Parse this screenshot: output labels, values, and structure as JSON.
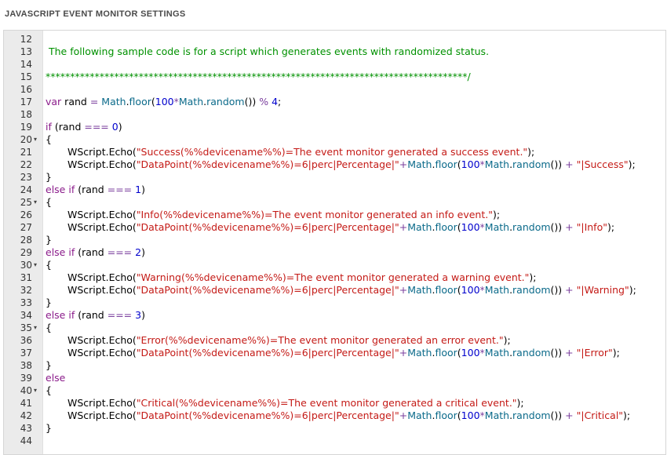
{
  "section": {
    "title": "JAVASCRIPT EVENT MONITOR SETTINGS"
  },
  "colors": {
    "gutter": "#ebebeb",
    "keyword": "#8b1c8b",
    "number": "#0000cd",
    "string": "#c41a16",
    "property": "#0b6a8a",
    "operator": "#7a3e9d",
    "comment": "#009100"
  },
  "editor": {
    "lines": [
      {
        "number": "12",
        "fold": false,
        "indent": false,
        "tokens": []
      },
      {
        "number": "13",
        "fold": false,
        "indent": false,
        "tokens": [
          {
            "t": "cm",
            "v": " The following sample code is for a script which generates events with randomized status."
          }
        ]
      },
      {
        "number": "14",
        "fold": false,
        "indent": false,
        "tokens": []
      },
      {
        "number": "15",
        "fold": false,
        "indent": false,
        "tokens": [
          {
            "t": "cm",
            "v": "**************************************************************************************/"
          }
        ]
      },
      {
        "number": "16",
        "fold": false,
        "indent": false,
        "tokens": []
      },
      {
        "number": "17",
        "fold": false,
        "indent": false,
        "tokens": [
          {
            "t": "kw",
            "v": "var"
          },
          {
            "t": "pl",
            "v": " rand "
          },
          {
            "t": "op",
            "v": "="
          },
          {
            "t": "pl",
            "v": " "
          },
          {
            "t": "prop",
            "v": "Math"
          },
          {
            "t": "pl",
            "v": "."
          },
          {
            "t": "prop",
            "v": "floor"
          },
          {
            "t": "pl",
            "v": "("
          },
          {
            "t": "num",
            "v": "100"
          },
          {
            "t": "op",
            "v": "*"
          },
          {
            "t": "prop",
            "v": "Math"
          },
          {
            "t": "pl",
            "v": "."
          },
          {
            "t": "prop",
            "v": "random"
          },
          {
            "t": "pl",
            "v": "()) "
          },
          {
            "t": "op",
            "v": "%"
          },
          {
            "t": "pl",
            "v": " "
          },
          {
            "t": "num",
            "v": "4"
          },
          {
            "t": "pl",
            "v": ";"
          }
        ]
      },
      {
        "number": "18",
        "fold": false,
        "indent": false,
        "tokens": []
      },
      {
        "number": "19",
        "fold": false,
        "indent": false,
        "tokens": [
          {
            "t": "kw",
            "v": "if"
          },
          {
            "t": "pl",
            "v": " (rand "
          },
          {
            "t": "op",
            "v": "==="
          },
          {
            "t": "pl",
            "v": " "
          },
          {
            "t": "num",
            "v": "0"
          },
          {
            "t": "pl",
            "v": ")"
          }
        ]
      },
      {
        "number": "20",
        "fold": true,
        "indent": false,
        "tokens": [
          {
            "t": "pl",
            "v": "{"
          }
        ]
      },
      {
        "number": "21",
        "fold": false,
        "indent": true,
        "tokens": [
          {
            "t": "pl",
            "v": "WScript.Echo("
          },
          {
            "t": "str",
            "v": "\"Success(%%devicename%%)=The event monitor generated a success event.\""
          },
          {
            "t": "pl",
            "v": ");"
          }
        ]
      },
      {
        "number": "22",
        "fold": false,
        "indent": true,
        "tokens": [
          {
            "t": "pl",
            "v": "WScript.Echo("
          },
          {
            "t": "str",
            "v": "\"DataPoint(%%devicename%%)=6|perc|Percentage|\""
          },
          {
            "t": "op",
            "v": "+"
          },
          {
            "t": "prop",
            "v": "Math"
          },
          {
            "t": "pl",
            "v": "."
          },
          {
            "t": "prop",
            "v": "floor"
          },
          {
            "t": "pl",
            "v": "("
          },
          {
            "t": "num",
            "v": "100"
          },
          {
            "t": "op",
            "v": "*"
          },
          {
            "t": "prop",
            "v": "Math"
          },
          {
            "t": "pl",
            "v": "."
          },
          {
            "t": "prop",
            "v": "random"
          },
          {
            "t": "pl",
            "v": "()) "
          },
          {
            "t": "op",
            "v": "+"
          },
          {
            "t": "pl",
            "v": " "
          },
          {
            "t": "str",
            "v": "\"|Success\""
          },
          {
            "t": "pl",
            "v": ");"
          }
        ]
      },
      {
        "number": "23",
        "fold": false,
        "indent": false,
        "tokens": [
          {
            "t": "pl",
            "v": "}"
          }
        ]
      },
      {
        "number": "24",
        "fold": false,
        "indent": false,
        "tokens": [
          {
            "t": "kw",
            "v": "else"
          },
          {
            "t": "pl",
            "v": " "
          },
          {
            "t": "kw",
            "v": "if"
          },
          {
            "t": "pl",
            "v": " (rand "
          },
          {
            "t": "op",
            "v": "==="
          },
          {
            "t": "pl",
            "v": " "
          },
          {
            "t": "num",
            "v": "1"
          },
          {
            "t": "pl",
            "v": ")"
          }
        ]
      },
      {
        "number": "25",
        "fold": true,
        "indent": false,
        "tokens": [
          {
            "t": "pl",
            "v": "{"
          }
        ]
      },
      {
        "number": "26",
        "fold": false,
        "indent": true,
        "tokens": [
          {
            "t": "pl",
            "v": "WScript.Echo("
          },
          {
            "t": "str",
            "v": "\"Info(%%devicename%%)=The event monitor generated an info event.\""
          },
          {
            "t": "pl",
            "v": ");"
          }
        ]
      },
      {
        "number": "27",
        "fold": false,
        "indent": true,
        "tokens": [
          {
            "t": "pl",
            "v": "WScript.Echo("
          },
          {
            "t": "str",
            "v": "\"DataPoint(%%devicename%%)=6|perc|Percentage|\""
          },
          {
            "t": "op",
            "v": "+"
          },
          {
            "t": "prop",
            "v": "Math"
          },
          {
            "t": "pl",
            "v": "."
          },
          {
            "t": "prop",
            "v": "floor"
          },
          {
            "t": "pl",
            "v": "("
          },
          {
            "t": "num",
            "v": "100"
          },
          {
            "t": "op",
            "v": "*"
          },
          {
            "t": "prop",
            "v": "Math"
          },
          {
            "t": "pl",
            "v": "."
          },
          {
            "t": "prop",
            "v": "random"
          },
          {
            "t": "pl",
            "v": "()) "
          },
          {
            "t": "op",
            "v": "+"
          },
          {
            "t": "pl",
            "v": " "
          },
          {
            "t": "str",
            "v": "\"|Info\""
          },
          {
            "t": "pl",
            "v": ");"
          }
        ]
      },
      {
        "number": "28",
        "fold": false,
        "indent": false,
        "tokens": [
          {
            "t": "pl",
            "v": "}"
          }
        ]
      },
      {
        "number": "29",
        "fold": false,
        "indent": false,
        "tokens": [
          {
            "t": "kw",
            "v": "else"
          },
          {
            "t": "pl",
            "v": " "
          },
          {
            "t": "kw",
            "v": "if"
          },
          {
            "t": "pl",
            "v": " (rand "
          },
          {
            "t": "op",
            "v": "==="
          },
          {
            "t": "pl",
            "v": " "
          },
          {
            "t": "num",
            "v": "2"
          },
          {
            "t": "pl",
            "v": ")"
          }
        ]
      },
      {
        "number": "30",
        "fold": true,
        "indent": false,
        "tokens": [
          {
            "t": "pl",
            "v": "{"
          }
        ]
      },
      {
        "number": "31",
        "fold": false,
        "indent": true,
        "tokens": [
          {
            "t": "pl",
            "v": "WScript.Echo("
          },
          {
            "t": "str",
            "v": "\"Warning(%%devicename%%)=The event monitor generated a warning event.\""
          },
          {
            "t": "pl",
            "v": ");"
          }
        ]
      },
      {
        "number": "32",
        "fold": false,
        "indent": true,
        "tokens": [
          {
            "t": "pl",
            "v": "WScript.Echo("
          },
          {
            "t": "str",
            "v": "\"DataPoint(%%devicename%%)=6|perc|Percentage|\""
          },
          {
            "t": "op",
            "v": "+"
          },
          {
            "t": "prop",
            "v": "Math"
          },
          {
            "t": "pl",
            "v": "."
          },
          {
            "t": "prop",
            "v": "floor"
          },
          {
            "t": "pl",
            "v": "("
          },
          {
            "t": "num",
            "v": "100"
          },
          {
            "t": "op",
            "v": "*"
          },
          {
            "t": "prop",
            "v": "Math"
          },
          {
            "t": "pl",
            "v": "."
          },
          {
            "t": "prop",
            "v": "random"
          },
          {
            "t": "pl",
            "v": "()) "
          },
          {
            "t": "op",
            "v": "+"
          },
          {
            "t": "pl",
            "v": " "
          },
          {
            "t": "str",
            "v": "\"|Warning\""
          },
          {
            "t": "pl",
            "v": ");"
          }
        ]
      },
      {
        "number": "33",
        "fold": false,
        "indent": false,
        "tokens": [
          {
            "t": "pl",
            "v": "}"
          }
        ]
      },
      {
        "number": "34",
        "fold": false,
        "indent": false,
        "tokens": [
          {
            "t": "kw",
            "v": "else"
          },
          {
            "t": "pl",
            "v": " "
          },
          {
            "t": "kw",
            "v": "if"
          },
          {
            "t": "pl",
            "v": " (rand "
          },
          {
            "t": "op",
            "v": "==="
          },
          {
            "t": "pl",
            "v": " "
          },
          {
            "t": "num",
            "v": "3"
          },
          {
            "t": "pl",
            "v": ")"
          }
        ]
      },
      {
        "number": "35",
        "fold": true,
        "indent": false,
        "tokens": [
          {
            "t": "pl",
            "v": "{"
          }
        ]
      },
      {
        "number": "36",
        "fold": false,
        "indent": true,
        "tokens": [
          {
            "t": "pl",
            "v": "WScript.Echo("
          },
          {
            "t": "str",
            "v": "\"Error(%%devicename%%)=The event monitor generated an error event.\""
          },
          {
            "t": "pl",
            "v": ");"
          }
        ]
      },
      {
        "number": "37",
        "fold": false,
        "indent": true,
        "tokens": [
          {
            "t": "pl",
            "v": "WScript.Echo("
          },
          {
            "t": "str",
            "v": "\"DataPoint(%%devicename%%)=6|perc|Percentage|\""
          },
          {
            "t": "op",
            "v": "+"
          },
          {
            "t": "prop",
            "v": "Math"
          },
          {
            "t": "pl",
            "v": "."
          },
          {
            "t": "prop",
            "v": "floor"
          },
          {
            "t": "pl",
            "v": "("
          },
          {
            "t": "num",
            "v": "100"
          },
          {
            "t": "op",
            "v": "*"
          },
          {
            "t": "prop",
            "v": "Math"
          },
          {
            "t": "pl",
            "v": "."
          },
          {
            "t": "prop",
            "v": "random"
          },
          {
            "t": "pl",
            "v": "()) "
          },
          {
            "t": "op",
            "v": "+"
          },
          {
            "t": "pl",
            "v": " "
          },
          {
            "t": "str",
            "v": "\"|Error\""
          },
          {
            "t": "pl",
            "v": ");"
          }
        ]
      },
      {
        "number": "38",
        "fold": false,
        "indent": false,
        "tokens": [
          {
            "t": "pl",
            "v": "}"
          }
        ]
      },
      {
        "number": "39",
        "fold": false,
        "indent": false,
        "tokens": [
          {
            "t": "kw",
            "v": "else"
          }
        ]
      },
      {
        "number": "40",
        "fold": true,
        "indent": false,
        "tokens": [
          {
            "t": "pl",
            "v": "{"
          }
        ]
      },
      {
        "number": "41",
        "fold": false,
        "indent": true,
        "tokens": [
          {
            "t": "pl",
            "v": "WScript.Echo("
          },
          {
            "t": "str",
            "v": "\"Critical(%%devicename%%)=The event monitor generated a critical event.\""
          },
          {
            "t": "pl",
            "v": ");"
          }
        ]
      },
      {
        "number": "42",
        "fold": false,
        "indent": true,
        "tokens": [
          {
            "t": "pl",
            "v": "WScript.Echo("
          },
          {
            "t": "str",
            "v": "\"DataPoint(%%devicename%%)=6|perc|Percentage|\""
          },
          {
            "t": "op",
            "v": "+"
          },
          {
            "t": "prop",
            "v": "Math"
          },
          {
            "t": "pl",
            "v": "."
          },
          {
            "t": "prop",
            "v": "floor"
          },
          {
            "t": "pl",
            "v": "("
          },
          {
            "t": "num",
            "v": "100"
          },
          {
            "t": "op",
            "v": "*"
          },
          {
            "t": "prop",
            "v": "Math"
          },
          {
            "t": "pl",
            "v": "."
          },
          {
            "t": "prop",
            "v": "random"
          },
          {
            "t": "pl",
            "v": "()) "
          },
          {
            "t": "op",
            "v": "+"
          },
          {
            "t": "pl",
            "v": " "
          },
          {
            "t": "str",
            "v": "\"|Critical\""
          },
          {
            "t": "pl",
            "v": ");"
          }
        ]
      },
      {
        "number": "43",
        "fold": false,
        "indent": false,
        "tokens": [
          {
            "t": "pl",
            "v": "}"
          }
        ]
      },
      {
        "number": "44",
        "fold": false,
        "indent": false,
        "tokens": []
      }
    ]
  }
}
